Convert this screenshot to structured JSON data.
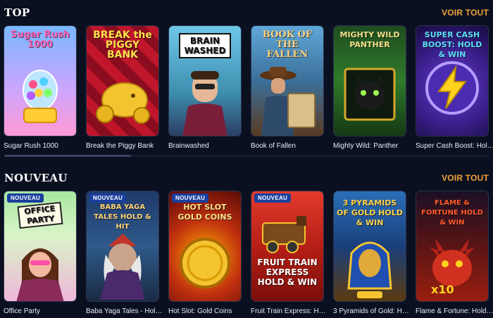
{
  "sections": {
    "top": {
      "title": "Top",
      "see_all": "VOIR TOUT",
      "games": [
        {
          "name": "Sugar Rush 1000",
          "logo": "Sugar Rush 1000"
        },
        {
          "name": "Break the Piggy Bank",
          "logo": "BREAK the PIGGY BANK"
        },
        {
          "name": "Brainwashed",
          "logo": "BRAIN WASHED"
        },
        {
          "name": "Book of Fallen",
          "logo": "BOOK OF THE FALLEN"
        },
        {
          "name": "Mighty Wild: Panther",
          "logo": "MIGHTY WILD PANTHER"
        },
        {
          "name": "Super Cash Boost: Hol…",
          "logo": "SUPER CASH BOOST: HOLD & WIN"
        }
      ]
    },
    "new": {
      "title": "Nouveau",
      "see_all": "VOIR TOUT",
      "badge": "NOUVEAU",
      "games": [
        {
          "name": "Office Party",
          "logo": "OFFICE PARTY"
        },
        {
          "name": "Baba Yaga Tales - Hol…",
          "logo": "BABA YAGA TALES HOLD & HIT"
        },
        {
          "name": "Hot Slot: Gold Coins",
          "logo": "HOT SLOT GOLD COINS"
        },
        {
          "name": "Fruit Train Express: H…",
          "logo": "FRUIT TRAIN EXPRESS HOLD & WIN"
        },
        {
          "name": "3 Pyramids of Gold: H…",
          "logo": "3 PYRAMIDS OF GOLD HOLD & WIN"
        },
        {
          "name": "Flame & Fortune: Hold…",
          "logo": "FLAME & FORTUNE HOLD & WIN"
        }
      ]
    }
  },
  "colors": {
    "background": "#0b1020",
    "accent": "#f0a23a",
    "badge": "#1a3f9e"
  }
}
